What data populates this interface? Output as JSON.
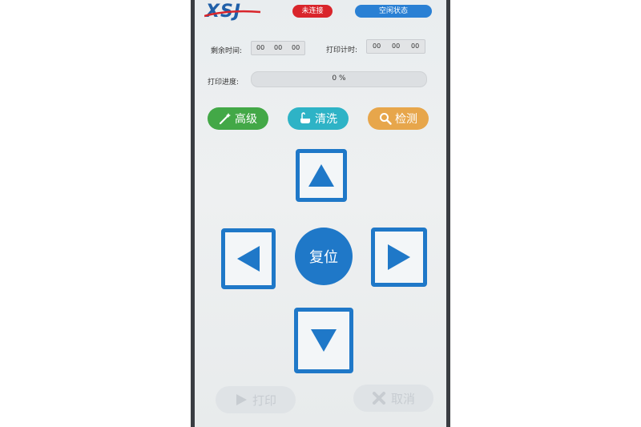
{
  "header": {
    "logo_text": "XSJ",
    "status_connection": "未连接",
    "status_machine": "空闲状态"
  },
  "timers": {
    "remaining_label": "剩余时间:",
    "remaining": {
      "h": "00",
      "m": "00",
      "s": "00"
    },
    "print_timer_label": "打印计时:",
    "print_timer": {
      "h": "00",
      "m": "00",
      "s": "00"
    }
  },
  "progress": {
    "label": "打印进度:",
    "value_percent": 0,
    "text": "0 %"
  },
  "actions": {
    "advanced_label": "高级",
    "clean_label": "清洗",
    "detect_label": "检测"
  },
  "dpad": {
    "reset_label": "复位"
  },
  "bottom": {
    "print_label": "打印",
    "cancel_label": "取消"
  },
  "colors": {
    "primary_blue": "#1f78c8",
    "status_red": "#d9252b",
    "status_blue": "#2a80d4",
    "green": "#43a847",
    "teal": "#2eb3c6",
    "orange": "#e7a64b",
    "disabled": "#dfe3e6"
  },
  "icons": {
    "advanced": "wand-icon",
    "clean": "bathtub-icon",
    "detect": "magnifier-icon",
    "up": "arrow-up-icon",
    "down": "arrow-down-icon",
    "left": "arrow-left-icon",
    "right": "arrow-right-icon",
    "print": "play-icon",
    "cancel": "cross-icon"
  }
}
